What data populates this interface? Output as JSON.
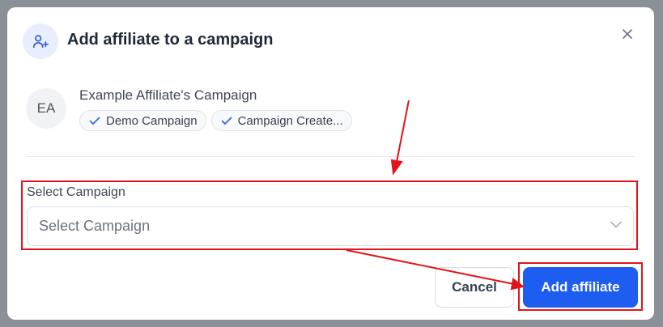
{
  "dialog": {
    "title": "Add affiliate to a campaign",
    "close_icon": "close-icon",
    "header_icon": "user-plus-icon"
  },
  "affiliate": {
    "initials": "EA",
    "name": "Example Affiliate's Campaign",
    "tags": [
      {
        "label": "Demo Campaign",
        "icon": "check-icon"
      },
      {
        "label": "Campaign Create...",
        "icon": "check-icon"
      }
    ]
  },
  "form": {
    "label": "Select Campaign",
    "placeholder": "Select Campaign"
  },
  "actions": {
    "cancel_label": "Cancel",
    "submit_label": "Add affiliate"
  },
  "colors": {
    "accent": "#1d5df0",
    "annotation": "#e3131b",
    "backdrop": "#8b8f96"
  }
}
